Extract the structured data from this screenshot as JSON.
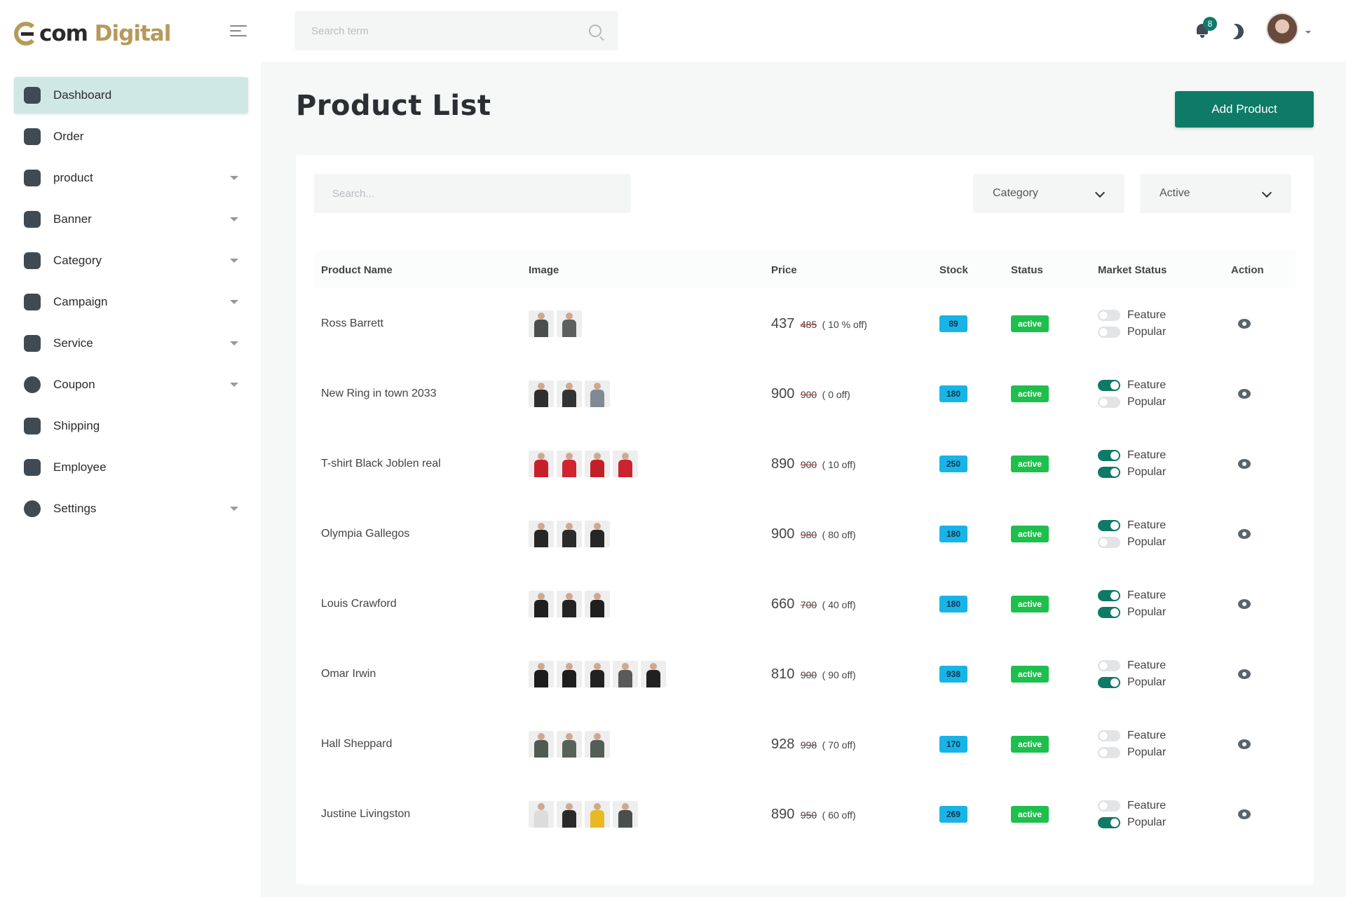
{
  "brand": {
    "logo_text_a": "com",
    "logo_text_b": "Digital"
  },
  "top_search": {
    "placeholder": "Search term"
  },
  "notifications": {
    "count": "8"
  },
  "sidebar": {
    "items": [
      {
        "label": "Dashboard",
        "icon": "home-icon",
        "active": true,
        "has_submenu": false
      },
      {
        "label": "Order",
        "icon": "cart-icon",
        "active": false,
        "has_submenu": false
      },
      {
        "label": "product",
        "icon": "box-icon",
        "active": false,
        "has_submenu": true
      },
      {
        "label": "Banner",
        "icon": "image-icon",
        "active": false,
        "has_submenu": true
      },
      {
        "label": "Category",
        "icon": "list-icon",
        "active": false,
        "has_submenu": true
      },
      {
        "label": "Campaign",
        "icon": "chart-icon",
        "active": false,
        "has_submenu": true
      },
      {
        "label": "Service",
        "icon": "medkit-icon",
        "active": false,
        "has_submenu": true
      },
      {
        "label": "Coupon",
        "icon": "dollar-icon",
        "active": false,
        "has_submenu": true
      },
      {
        "label": "Shipping",
        "icon": "bike-icon",
        "active": false,
        "has_submenu": false
      },
      {
        "label": "Employee",
        "icon": "users-icon",
        "active": false,
        "has_submenu": false
      },
      {
        "label": "Settings",
        "icon": "gear-icon",
        "active": false,
        "has_submenu": true
      }
    ]
  },
  "page": {
    "title": "Product List",
    "add_button": "Add Product"
  },
  "filters": {
    "search_placeholder": "Search...",
    "category": "Category",
    "status": "Active"
  },
  "table": {
    "headers": [
      "Product Name",
      "Image",
      "Price",
      "Stock",
      "Status",
      "Market Status",
      "Action"
    ],
    "rows": [
      {
        "name": "Ross Barrett",
        "image_colors": [
          "#4a4f4d",
          "#5b605e"
        ],
        "price": "437",
        "old_price": "485",
        "off": "( 10 % off)",
        "stock": "89",
        "status": "active",
        "feature": false,
        "popular": false
      },
      {
        "name": "New Ring in town 2033",
        "image_colors": [
          "#2e2e2e",
          "#333333",
          "#7f8a94"
        ],
        "price": "900",
        "old_price": "900",
        "off": "( 0 off)",
        "stock": "180",
        "status": "active",
        "feature": true,
        "popular": false
      },
      {
        "name": "T-shirt Black Joblen real",
        "image_colors": [
          "#c8202a",
          "#d0242e",
          "#c41f29",
          "#ca2430"
        ],
        "price": "890",
        "old_price": "900",
        "off": "( 10 off)",
        "stock": "250",
        "status": "active",
        "feature": true,
        "popular": true
      },
      {
        "name": "Olympia Gallegos",
        "image_colors": [
          "#262626",
          "#2b2b2b",
          "#262626"
        ],
        "price": "900",
        "old_price": "980",
        "off": "( 80 off)",
        "stock": "180",
        "status": "active",
        "feature": true,
        "popular": false
      },
      {
        "name": "Louis Crawford",
        "image_colors": [
          "#1f1f1f",
          "#232323",
          "#1f1f1f"
        ],
        "price": "660",
        "old_price": "700",
        "off": "( 40 off)",
        "stock": "180",
        "status": "active",
        "feature": true,
        "popular": true
      },
      {
        "name": "Omar Irwin",
        "image_colors": [
          "#1c1c1c",
          "#1e1e1e",
          "#222222",
          "#5a5a5a",
          "#202020"
        ],
        "price": "810",
        "old_price": "900",
        "off": "( 90 off)",
        "stock": "938",
        "status": "active",
        "feature": false,
        "popular": true
      },
      {
        "name": "Hall Sheppard",
        "image_colors": [
          "#4e5a52",
          "#56625a",
          "#525e56"
        ],
        "price": "928",
        "old_price": "998",
        "off": "( 70 off)",
        "stock": "170",
        "status": "active",
        "feature": false,
        "popular": false
      },
      {
        "name": "Justine Livingston",
        "image_colors": [
          "#dcdcdc",
          "#2a2a2a",
          "#e8b923",
          "#4a4f4d"
        ],
        "price": "890",
        "old_price": "950",
        "off": "( 60 off)",
        "stock": "269",
        "status": "active",
        "feature": false,
        "popular": true
      }
    ],
    "feature_label": "Feature",
    "popular_label": "Popular"
  },
  "colors": {
    "accent": "#0e7a68",
    "stock_badge": "#19b4e6",
    "status_badge": "#1fbf4d",
    "sidebar_active": "#cfe8e6"
  }
}
